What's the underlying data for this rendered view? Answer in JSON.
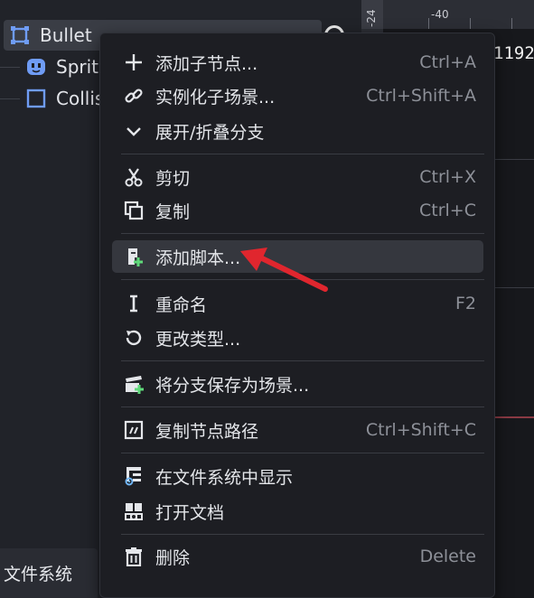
{
  "scene_tree": {
    "nodes": [
      {
        "label": "Bullet",
        "icon": "node2d-icon",
        "selected": true
      },
      {
        "label": "Sprit",
        "icon": "sprite-icon"
      },
      {
        "label": "Collis",
        "icon": "collision-shape-icon"
      }
    ],
    "bottom_tab_label": "文件系统"
  },
  "viewport": {
    "ruler_top_number": "-40",
    "ruler_left_number": "-24",
    "coordinate_readout": "1192"
  },
  "context_menu": {
    "hovered_index": 4,
    "items": [
      {
        "label": "添加子节点...",
        "shortcut": "Ctrl+A",
        "icon": "plus-icon"
      },
      {
        "label": "实例化子场景...",
        "shortcut": "Ctrl+Shift+A",
        "icon": "link-icon"
      },
      {
        "label": "展开/折叠分支",
        "shortcut": "",
        "icon": "chevron-down-icon"
      },
      {
        "label": "剪切",
        "shortcut": "Ctrl+X",
        "icon": "scissors-icon"
      },
      {
        "label": "复制",
        "shortcut": "Ctrl+C",
        "icon": "copy-icon"
      },
      {
        "label": "添加脚本...",
        "shortcut": "",
        "icon": "script-add-icon"
      },
      {
        "label": "重命名",
        "shortcut": "F2",
        "icon": "text-cursor-icon"
      },
      {
        "label": "更改类型...",
        "shortcut": "",
        "icon": "rotate-icon"
      },
      {
        "label": "将分支保存为场景...",
        "shortcut": "",
        "icon": "save-scene-icon"
      },
      {
        "label": "复制节点路径",
        "shortcut": "Ctrl+Shift+C",
        "icon": "node-path-icon"
      },
      {
        "label": "在文件系统中显示",
        "shortcut": "",
        "icon": "filesystem-icon"
      },
      {
        "label": "打开文档",
        "shortcut": "",
        "icon": "doc-icon"
      },
      {
        "label": "删除",
        "shortcut": "Delete",
        "icon": "trash-icon"
      }
    ]
  },
  "annotation": {
    "icon": "red-arrow-icon",
    "color": "#e0262e"
  },
  "colors": {
    "accent_blue": "#6f9cf5",
    "plus_green": "#5fd97a"
  }
}
